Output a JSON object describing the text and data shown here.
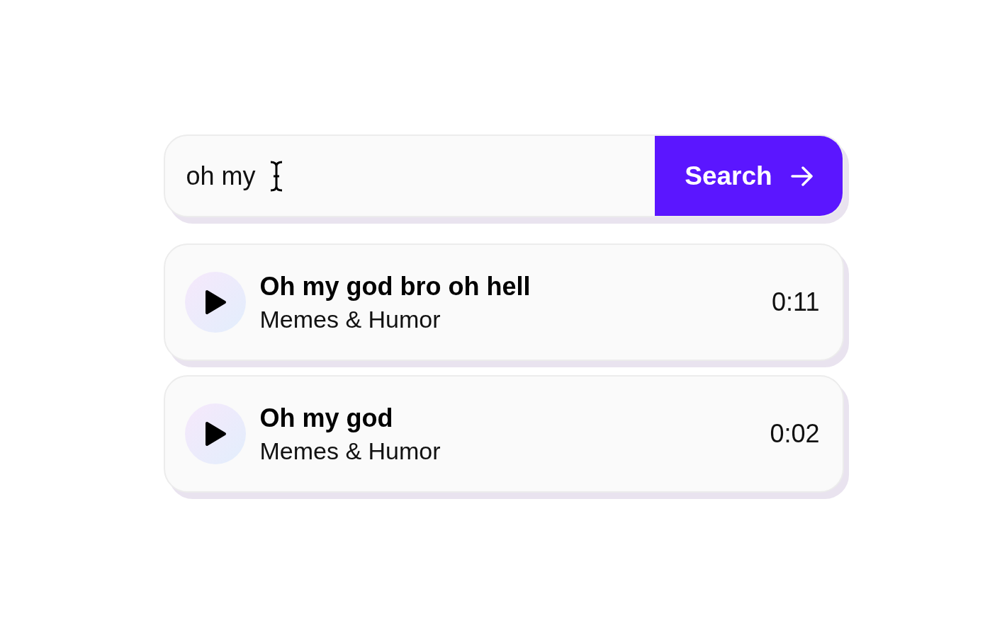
{
  "search": {
    "value": "oh my",
    "button": "Search"
  },
  "results": [
    {
      "title": "Oh my god bro oh hell",
      "category": "Memes & Humor",
      "duration": "0:11"
    },
    {
      "title": "Oh my god",
      "category": "Memes & Humor",
      "duration": "0:02"
    }
  ]
}
